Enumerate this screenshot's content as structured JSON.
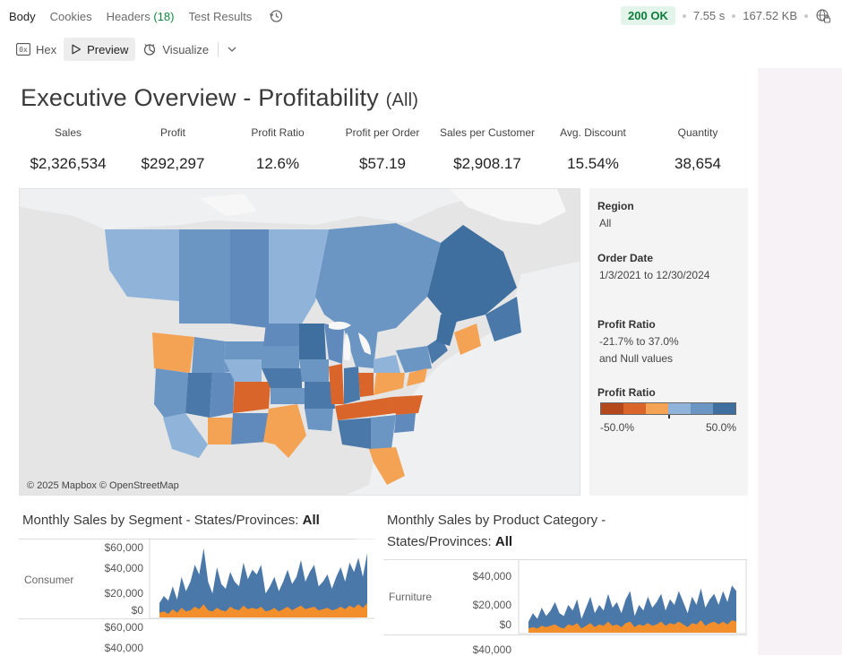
{
  "tabs": {
    "body": "Body",
    "cookies": "Cookies",
    "headers_label": "Headers",
    "headers_count": "(18)",
    "test_results": "Test Results"
  },
  "response": {
    "status": "200 OK",
    "time": "7.55 s",
    "size": "167.52 KB"
  },
  "view_modes": {
    "hex": "Hex",
    "preview": "Preview",
    "visualize": "Visualize"
  },
  "dashboard": {
    "title": "Executive Overview - Profitability",
    "title_filter": "(All)",
    "kpis": [
      {
        "label": "Sales",
        "value": "$2,326,534"
      },
      {
        "label": "Profit",
        "value": "$292,297"
      },
      {
        "label": "Profit Ratio",
        "value": "12.6%"
      },
      {
        "label": "Profit per Order",
        "value": "$57.19"
      },
      {
        "label": "Sales per Customer",
        "value": "$2,908.17"
      },
      {
        "label": "Avg. Discount",
        "value": "15.54%"
      },
      {
        "label": "Quantity",
        "value": "38,654"
      }
    ],
    "map_credit": "© 2025 Mapbox © OpenStreetMap",
    "filters": {
      "region_label": "Region",
      "region_value": "All",
      "order_date_label": "Order Date",
      "order_date_value": "1/3/2021 to 12/30/2024",
      "profit_ratio_label": "Profit Ratio",
      "profit_ratio_range": "-21.7% to 37.0%",
      "profit_ratio_null": "and Null values",
      "legend_label": "Profit Ratio",
      "legend_min": "-50.0%",
      "legend_max": "50.0%",
      "legend_colors": [
        "#b5471d",
        "#d9652a",
        "#f4a354",
        "#8fb3d9",
        "#6b96c4",
        "#3f6f9f"
      ]
    },
    "segment_chart": {
      "title": "Monthly Sales by Segment - States/Provinces:",
      "title_bold": "All",
      "row1_label": "Consumer",
      "row1_ticks": [
        "$60,000",
        "$40,000",
        "$20,000",
        "$0"
      ],
      "row2_ticks": [
        "$60,000",
        "$40,000"
      ]
    },
    "category_chart": {
      "title_line1": "Monthly Sales by Product Category -",
      "title_line2": "States/Provinces:",
      "title_bold": "All",
      "row1_label": "Furniture",
      "row1_ticks": [
        "$40,000",
        "$20,000",
        "$0"
      ],
      "row2_ticks": [
        "$40,000"
      ]
    },
    "colors": {
      "series_blue": "#4a78a8",
      "series_orange": "#f28e2b"
    }
  },
  "chart_data": [
    {
      "type": "area",
      "title": "Monthly Sales by Segment - States/Provinces: All",
      "row": "Consumer",
      "ylim": [
        0,
        60000
      ],
      "series": [
        {
          "values": [
            12000,
            18000,
            14000,
            26000,
            15000,
            34000,
            22000,
            30000,
            44000,
            36000,
            58000,
            30000,
            20000,
            42000,
            28000,
            24000,
            38000,
            30000,
            26000,
            46000,
            32000,
            40000,
            36000,
            44000,
            20000,
            26000,
            34000,
            22000,
            30000,
            40000,
            28000,
            34000,
            48000,
            30000,
            38000,
            44000,
            26000,
            30000,
            36000,
            24000,
            34000,
            42000,
            30000,
            46000,
            38000,
            50000,
            34000,
            54000
          ]
        },
        {
          "values": [
            4000,
            5000,
            3000,
            7000,
            4000,
            8000,
            5000,
            6000,
            9000,
            7000,
            11000,
            6000,
            5000,
            8000,
            6000,
            5000,
            9000,
            7000,
            6000,
            10000,
            7000,
            8000,
            7000,
            9000,
            5000,
            6000,
            8000,
            5000,
            7000,
            9000,
            6000,
            8000,
            10000,
            7000,
            8000,
            9000,
            6000,
            7000,
            8000,
            6000,
            7000,
            9000,
            7000,
            10000,
            8000,
            11000,
            8000,
            12000
          ]
        }
      ]
    },
    {
      "type": "area",
      "title": "Monthly Sales by Product Category - States/Provinces: All",
      "row": "Furniture",
      "ylim": [
        0,
        40000
      ],
      "series": [
        {
          "values": [
            8000,
            14000,
            10000,
            18000,
            12000,
            16000,
            22000,
            14000,
            12000,
            20000,
            16000,
            24000,
            10000,
            18000,
            26000,
            14000,
            20000,
            16000,
            28000,
            18000,
            22000,
            14000,
            24000,
            30000,
            12000,
            20000,
            16000,
            26000,
            18000,
            22000,
            28000,
            16000,
            24000,
            20000,
            30000,
            22000,
            14000,
            26000,
            20000,
            32000,
            18000,
            24000,
            28000,
            20000,
            30000,
            22000,
            34000,
            30000
          ]
        },
        {
          "values": [
            3000,
            4000,
            3000,
            5000,
            4000,
            5000,
            6000,
            4000,
            3000,
            6000,
            5000,
            7000,
            3000,
            5000,
            7000,
            4000,
            6000,
            5000,
            8000,
            5000,
            6000,
            4000,
            7000,
            8000,
            4000,
            6000,
            5000,
            7000,
            5000,
            6000,
            8000,
            5000,
            7000,
            6000,
            8000,
            6000,
            4000,
            7000,
            6000,
            9000,
            5000,
            7000,
            8000,
            6000,
            8000,
            6000,
            9000,
            8000
          ]
        }
      ]
    }
  ]
}
